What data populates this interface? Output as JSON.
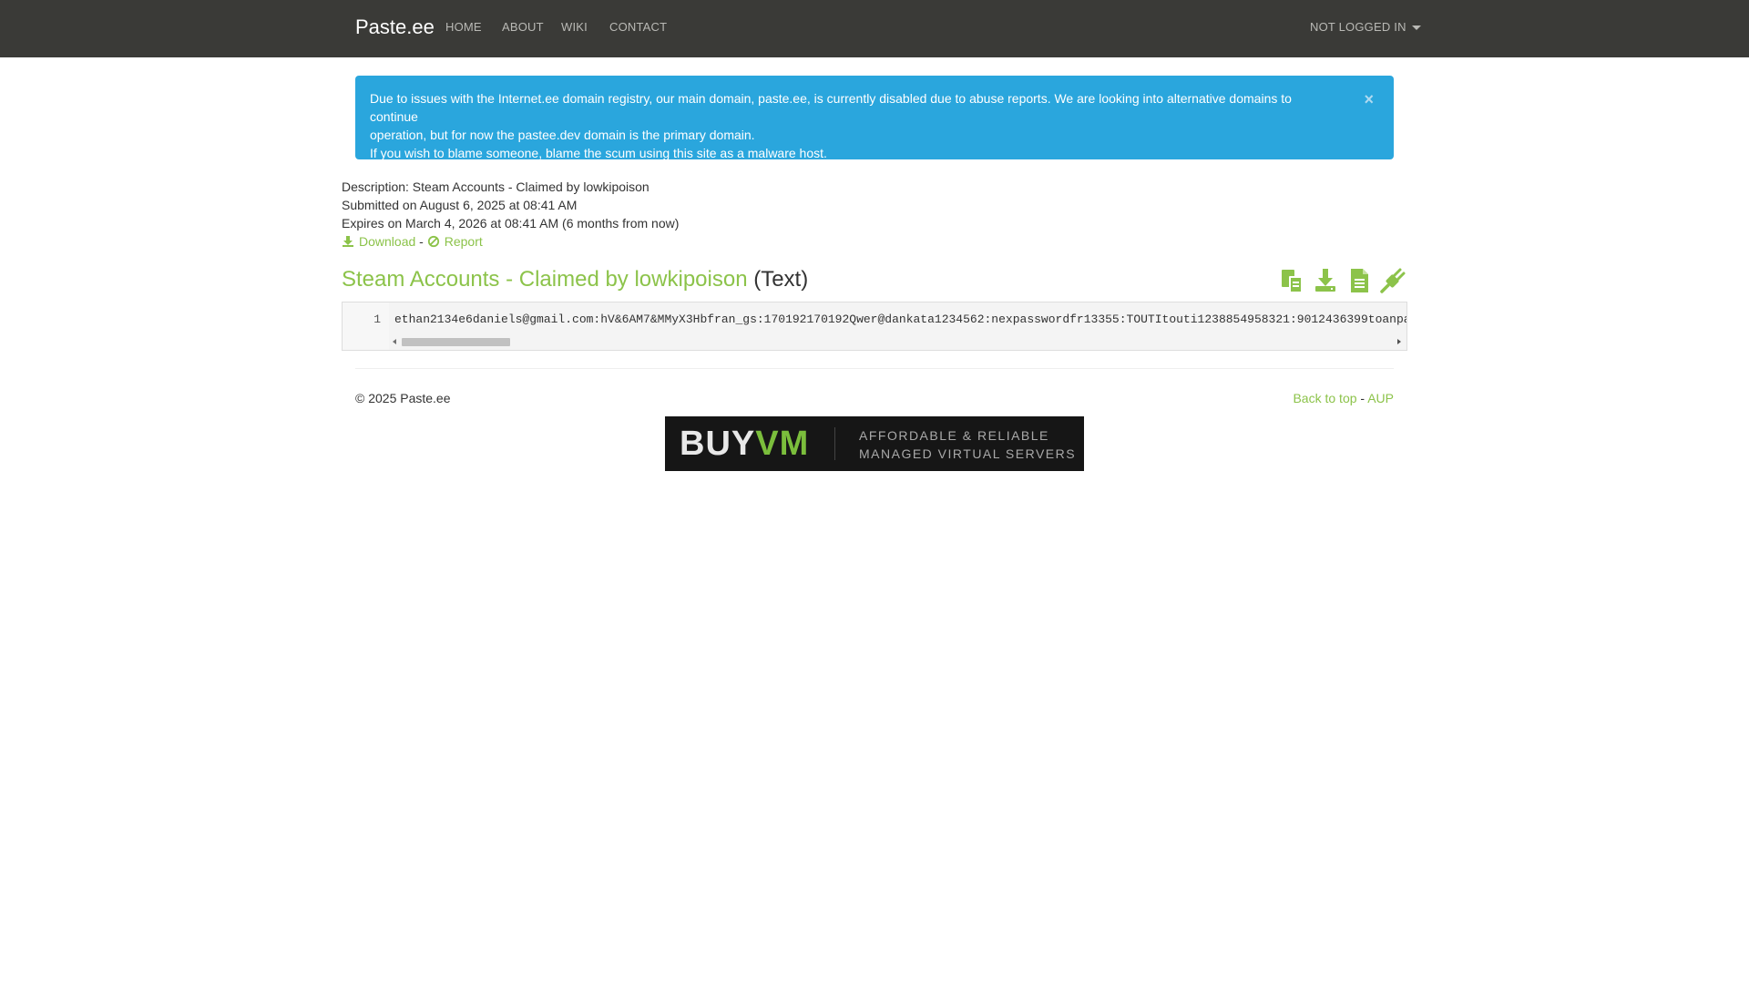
{
  "nav": {
    "brand": "Paste.ee",
    "links": [
      "HOME",
      "ABOUT",
      "WIKI",
      "CONTACT"
    ],
    "account": "NOT LOGGED IN"
  },
  "alert": {
    "line1": "Due to issues with the Internet.ee domain registry, our main domain, paste.ee, is currently disabled due to abuse reports. We are looking into alternative domains to continue",
    "line2": "operation, but for now the pastee.dev domain is the primary domain.",
    "line3": "If you wish to blame someone, blame the scum using this site as a malware host.",
    "close": "×"
  },
  "meta": {
    "description": "Description: Steam Accounts - Claimed by lowkipoison",
    "submitted": "Submitted on August 6, 2025 at 08:41 AM",
    "expires": "Expires on March 4, 2026 at 08:41 AM (6 months from now)",
    "download": "Download",
    "separator": "-",
    "report": "Report"
  },
  "paste": {
    "name": "Steam Accounts - Claimed by lowkipoison",
    "format": "(Text)",
    "line_number": "1",
    "content": "ethan2134e6daniels@gmail.com:hV&6AM7&MMyX3Hbfran_gs:170192170192Qwer@dankata1234562:nexpasswordfr13355:TOUTItouti1238854958321:9012436399toanpa"
  },
  "footer": {
    "copyright": "© 2025 Paste.ee",
    "back_to_top": "Back to top",
    "dash": "-",
    "aup": "AUP"
  },
  "ad": {
    "brand_buy": "BUY",
    "brand_vm": "VM",
    "tagline1": "AFFORDABLE & RELIABLE",
    "tagline2": "MANAGED VIRTUAL SERVERS"
  },
  "colors": {
    "navbar": "#3a3a37",
    "accent_green": "#8cc34a",
    "alert_blue": "#2aa6dd"
  },
  "icons": [
    "copy-icon",
    "download-icon",
    "raw-icon",
    "embed-icon",
    "report-icon"
  ]
}
